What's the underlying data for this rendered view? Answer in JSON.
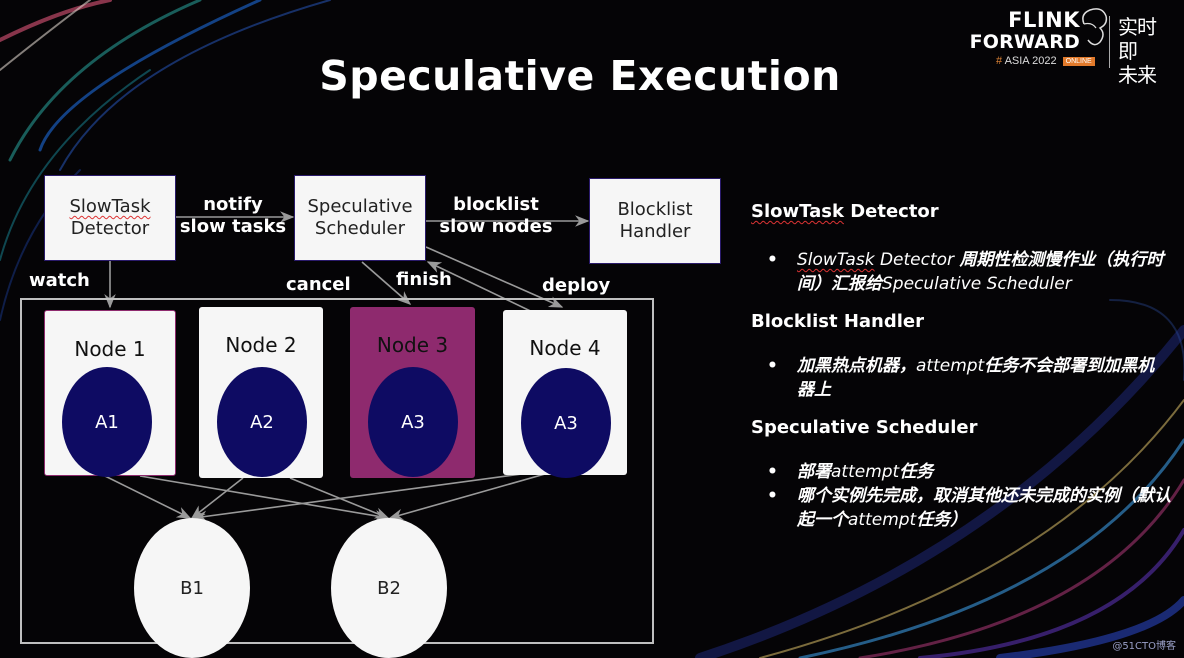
{
  "slide": {
    "title": "Speculative Execution",
    "watermark": "@51CTO博客"
  },
  "logo": {
    "line1": "FLINK",
    "line2": "FORWARD",
    "hash": "#",
    "event": "ASIA 2022",
    "badge": "ONLINE",
    "slogan_line1": "实时即",
    "slogan_line2": "未来",
    "accent_color": "#e27a2b"
  },
  "diagram": {
    "components": [
      {
        "id": "detector",
        "line1": "SlowTask",
        "line2": "Detector"
      },
      {
        "id": "scheduler",
        "line1": "Speculative",
        "line2": "Scheduler"
      },
      {
        "id": "handler",
        "line1": "Blocklist",
        "line2": "Handler"
      }
    ],
    "edge_labels": {
      "notify_line1": "notify",
      "notify_line2": "slow tasks",
      "blocklist_line1": "blocklist",
      "blocklist_line2": "slow nodes",
      "watch": "watch",
      "cancel": "cancel",
      "finish": "finish",
      "deploy": "deploy"
    },
    "nodes": [
      {
        "label": "Node 1",
        "task": "A1",
        "state": "normal"
      },
      {
        "label": "Node 2",
        "task": "A2",
        "state": "normal"
      },
      {
        "label": "Node 3",
        "task": "A3",
        "state": "slow"
      },
      {
        "label": "Node 4",
        "task": "A3",
        "state": "speculative"
      }
    ],
    "downstream": [
      {
        "label": "B1"
      },
      {
        "label": "B2"
      }
    ],
    "colors": {
      "slow_node": "#8e2a6e",
      "task": "#0e0b63",
      "box": "#f6f6f6",
      "arrow": "#9a9a9a"
    }
  },
  "panel": {
    "sections": [
      {
        "title_a": "SlowTask",
        "title_b": " Detector",
        "bullets": [
          {
            "a": "SlowTask",
            "b": " Detector ",
            "c": "周期性检测慢作业（执行时间）汇报给",
            "d": "Speculative Scheduler"
          }
        ]
      },
      {
        "title": "Blocklist Handler",
        "bullets": [
          {
            "a": "加黑热点机器，",
            "b": "attempt",
            "c": "任务不会部署到加黑机器上"
          }
        ]
      },
      {
        "title": "Speculative Scheduler",
        "bullets": [
          {
            "a": "部署",
            "b": "attempt",
            "c": "任务"
          },
          {
            "a": "哪个实例先完成，取消其他还未完成的实例（默认起一个",
            "b": "attempt",
            "c": "任务）"
          }
        ]
      }
    ],
    "bullet_glyph": "•"
  }
}
